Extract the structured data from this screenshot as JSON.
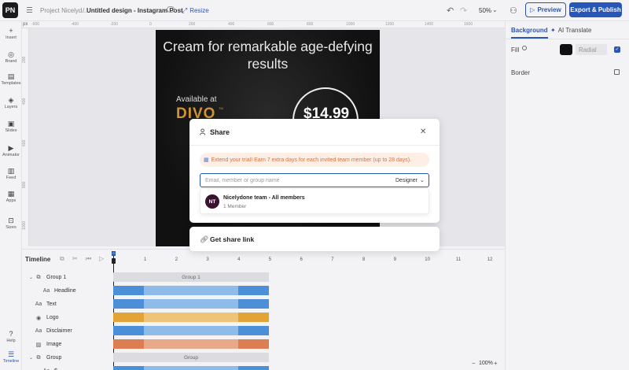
{
  "topbar": {
    "logo_text": "PN",
    "project": "Project Nicelyd...",
    "separator": "/",
    "design_title": "Untitled design - Instagram Post",
    "resize_label": "Resize",
    "zoom_value": "50%",
    "preview_label": "Preview",
    "export_label": "Export & Publish"
  },
  "sidebar": {
    "items": [
      {
        "label": "Insert",
        "icon": "+"
      },
      {
        "label": "Brand",
        "icon": "◎"
      },
      {
        "label": "Templates",
        "icon": "▤"
      },
      {
        "label": "Layers",
        "icon": "◈"
      },
      {
        "label": "Slides",
        "icon": "▣"
      },
      {
        "label": "Animator",
        "icon": "▶"
      },
      {
        "label": "Feed",
        "icon": "▥"
      },
      {
        "label": "Apps",
        "icon": "▦"
      },
      {
        "label": "Sizes",
        "icon": "⊡"
      },
      {
        "label": "Help",
        "icon": "?"
      },
      {
        "label": "Timeline",
        "icon": "☰"
      }
    ]
  },
  "ruler": {
    "unit": "px",
    "h_ticks": [
      "-600",
      "-400",
      "-200",
      "0",
      "200",
      "400",
      "600",
      "800",
      "1000",
      "1200",
      "1400",
      "1600"
    ],
    "v_ticks": [
      "200",
      "400",
      "600",
      "800",
      "1000"
    ]
  },
  "design": {
    "headline": "Cream for remarkable age-defying results",
    "available": "Available at",
    "brand": "DIVO",
    "brand_tm": "TM",
    "price": "$14.99"
  },
  "right_panel": {
    "tab_background": "Background",
    "tab_ai": "AI Translate",
    "fill_label": "Fill",
    "fill_type": "Radial",
    "border_label": "Border"
  },
  "timeline": {
    "title": "Timeline",
    "seconds": [
      "1",
      "2",
      "3",
      "4",
      "5",
      "6",
      "7",
      "8",
      "9",
      "10",
      "11",
      "12"
    ],
    "playhead_label": "0",
    "layers": [
      {
        "name": "Group 1",
        "kind": "group",
        "indent": 0,
        "icon": "⧉"
      },
      {
        "name": "Headline",
        "kind": "text",
        "indent": 1,
        "icon": "Aa"
      },
      {
        "name": "Text",
        "kind": "text",
        "indent": 0,
        "icon": "Aa"
      },
      {
        "name": "Logo",
        "kind": "image",
        "indent": 0,
        "icon": "◉"
      },
      {
        "name": "Disclaimer",
        "kind": "text",
        "indent": 0,
        "icon": "Aa"
      },
      {
        "name": "Image",
        "kind": "image",
        "indent": 0,
        "icon": "▨"
      },
      {
        "name": "Group",
        "kind": "group",
        "indent": 0,
        "icon": "⧉"
      },
      {
        "name": "$",
        "kind": "text",
        "indent": 1,
        "icon": "Aa"
      }
    ],
    "group1_track_label": "Group 1",
    "group_track_label": "Group",
    "zoom_value": "100%",
    "colors": {
      "blue": "#4a8fd8",
      "blue_light": "#8fbbe8",
      "orange": "#e3a437",
      "orange_dark": "#d98b4e",
      "red_orange": "#dc7e54"
    }
  },
  "share": {
    "title": "Share",
    "trial_text": "Extend your trial! Earn 7 extra days for each invited team member (up to 28 days).",
    "input_placeholder": "Email, member or group name",
    "role": "Designer",
    "team_initials": "NT",
    "team_name": "Nicelydone team - All members",
    "team_count": "1 Member",
    "link_label": "Get share link"
  }
}
